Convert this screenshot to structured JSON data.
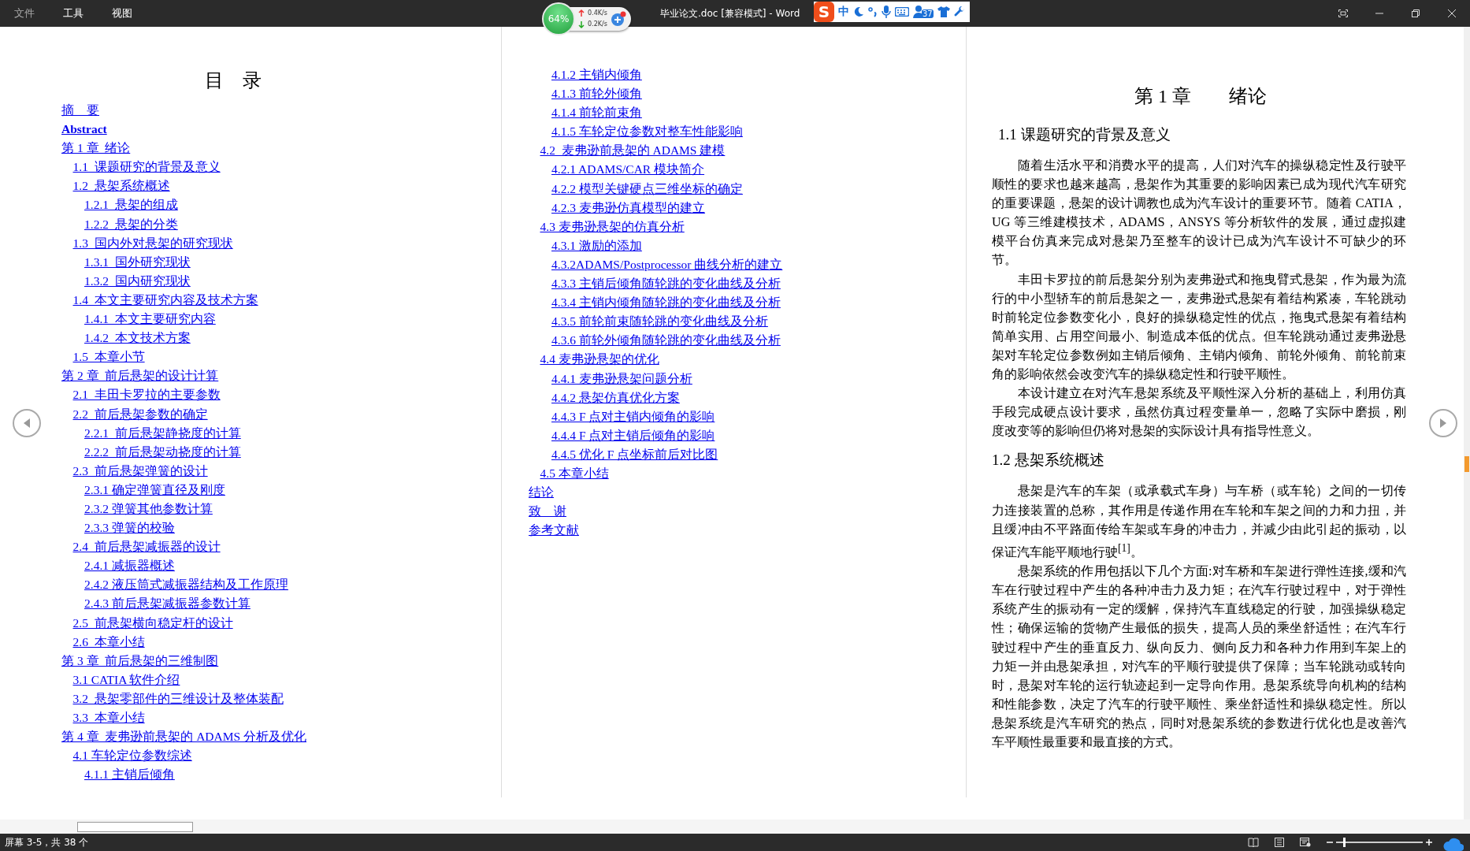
{
  "menu": [
    "文件",
    "工具",
    "视图"
  ],
  "monitor": {
    "percent": "64%",
    "upload": "0.4K/s",
    "download": "0.2K/s"
  },
  "window": {
    "title": "毕业论文.doc [兼容模式] - Word"
  },
  "ime_toolbar": {
    "logo": "S",
    "mode": "中",
    "badge": "37"
  },
  "toc": {
    "title": "目　录",
    "items": [
      {
        "label": "摘　要"
      },
      {
        "label": "Abstract",
        "bold": true
      },
      {
        "label": "第 1 章  绪论",
        "children": [
          {
            "label": "1.1  课题研究的背景及意义"
          },
          {
            "label": "1.2  悬架系统概述",
            "children": [
              {
                "label": "1.2.1  悬架的组成"
              },
              {
                "label": "1.2.2  悬架的分类"
              }
            ]
          },
          {
            "label": "1.3  国内外对悬架的研究现状",
            "children": [
              {
                "label": "1.3.1  国外研究现状"
              },
              {
                "label": "1.3.2  国内研究现状"
              }
            ]
          },
          {
            "label": "1.4  本文主要研究内容及技术方案",
            "children": [
              {
                "label": "1.4.1  本文主要研究内容"
              },
              {
                "label": "1.4.2  本文技术方案"
              }
            ]
          },
          {
            "label": "1.5  本章小节"
          }
        ]
      },
      {
        "label": "第 2 章  前后悬架的设计计算",
        "children": [
          {
            "label": "2.1  丰田卡罗拉的主要参数"
          },
          {
            "label": "2.2  前后悬架参数的确定",
            "children": [
              {
                "label": "2.2.1  前后悬架静挠度的计算"
              },
              {
                "label": "2.2.2  前后悬架动挠度的计算"
              }
            ]
          },
          {
            "label": "2.3  前后悬架弹簧的设计",
            "children": [
              {
                "label": "2.3.1 确定弹簧直径及刚度"
              },
              {
                "label": "2.3.2 弹簧其他参数计算"
              },
              {
                "label": "2.3.3 弹簧的校验"
              }
            ]
          },
          {
            "label": "2.4  前后悬架减振器的设计",
            "children": [
              {
                "label": "2.4.1 减振器概述"
              },
              {
                "label": "2.4.2 液压筒式减振器结构及工作原理"
              },
              {
                "label": "2.4.3 前后悬架减振器参数计算"
              }
            ]
          },
          {
            "label": "2.5  前悬架横向稳定杆的设计"
          },
          {
            "label": "2.6  本章小结"
          }
        ]
      },
      {
        "label": "第 3 章  前后悬架的三维制图",
        "children": [
          {
            "label": "3.1 CATIA 软件介绍"
          },
          {
            "label": "3.2  悬架零部件的三维设计及整体装配"
          },
          {
            "label": "3.3  本章小结"
          }
        ]
      },
      {
        "label": "第 4 章  麦弗逊前悬架的 ADAMS 分析及优化",
        "children": [
          {
            "label": "4.1 车轮定位参数综述",
            "children": [
              {
                "label": "4.1.1 主销后倾角"
              },
              {
                "label": "4.1.2 主销内倾角"
              },
              {
                "label": "4.1.3 前轮外倾角"
              },
              {
                "label": "4.1.4 前轮前束角"
              },
              {
                "label": "4.1.5 车轮定位参数对整车性能影响"
              }
            ]
          },
          {
            "label": "4.2  麦弗逊前悬架的 ADAMS 建模",
            "children": [
              {
                "label": "4.2.1 ADAMS/CAR 模块简介"
              },
              {
                "label": "4.2.2 模型关键硬点三维坐标的确定"
              },
              {
                "label": "4.2.3 麦弗逊仿真模型的建立"
              }
            ]
          },
          {
            "label": "4.3 麦弗逊悬架的仿真分析",
            "children": [
              {
                "label": "4.3.1 激励的添加"
              },
              {
                "label": "4.3.2ADAMS/Postprocessor 曲线分析的建立"
              },
              {
                "label": "4.3.3 主销后倾角随轮跳的变化曲线及分析"
              },
              {
                "label": "4.3.4 主销内倾角随轮跳的变化曲线及分析"
              },
              {
                "label": "4.3.5 前轮前束随轮跳的变化曲线及分析"
              },
              {
                "label": "4.3.6 前轮外倾角随轮跳的变化曲线及分析"
              }
            ]
          },
          {
            "label": "4.4 麦弗逊悬架的优化",
            "children": [
              {
                "label": "4.4.1 麦弗逊悬架问题分析"
              },
              {
                "label": "4.4.2 悬架仿真优化方案"
              },
              {
                "label": "4.4.3 F 点对主销内倾角的影响"
              },
              {
                "label": "4.4.4 F 点对主销后倾角的影响"
              },
              {
                "label": "4.4.5 优化 F 点坐标前后对比图"
              }
            ]
          },
          {
            "label": "4.5 本章小结"
          }
        ]
      },
      {
        "label": "结论"
      },
      {
        "label": "致　谢"
      },
      {
        "label": "参考文献"
      }
    ]
  },
  "chapter": {
    "title": "第 1 章　　绪论",
    "sections": [
      {
        "heading": "1.1 课题研究的背景及意义",
        "paragraphs": [
          "随着生活水平和消费水平的提高，人们对汽车的操纵稳定性及行驶平顺性的要求也越来越高，悬架作为其重要的影响因素已成为现代汽车研究的重要课题，悬架的设计调教也成为汽车设计的重要环节。随着 CATIA，UG 等三维建模技术，ADAMS，ANSYS 等分析软件的发展，通过虚拟建模平台仿真来完成对悬架乃至整车的设计已成为汽车设计不可缺少的环节。",
          "丰田卡罗拉的前后悬架分别为麦弗逊式和拖曳臂式悬架，作为最为流行的中小型轿车的前后悬架之一，麦弗逊式悬架有着结构紧凑，车轮跳动时前轮定位参数变化小，良好的操纵稳定性的优点，拖曳式悬架有着结构简单实用、占用空间最小、制造成本低的优点。但车轮跳动通过麦弗逊悬架对车轮定位参数例如主销后倾角、主销内倾角、前轮外倾角、前轮前束角的影响依然会改变汽车的操纵稳定性和行驶平顺性。",
          "本设计建立在对汽车悬架系统及平顺性深入分析的基础上，利用仿真手段完成硬点设计要求，虽然仿真过程变量单一，忽略了实际中磨损，刚度改变等的影响但仍将对悬架的实际设计具有指导性意义。"
        ]
      },
      {
        "heading": "1.2 悬架系统概述",
        "paragraphs": [
          "悬架是汽车的车架（或承载式车身）与车桥（或车轮）之间的一切传力连接装置的总称，其作用是传递作用在车轮和车架之间的力和力扭，并且缓冲由不平路面传给车架或车身的冲击力，并减少由此引起的振动，以保证汽车能平顺地行驶$^{[1]}$。",
          "悬架系统的作用包括以下几个方面:对车桥和车架进行弹性连接,缓和汽车在行驶过程中产生的各种冲击力及力矩；在汽车行驶过程中，对于弹性系统产生的振动有一定的缓解，保持汽车直线稳定的行驶，加强操纵稳定性；确保运输的货物产生最低的损失，提高人员的乘坐舒适性；在汽车行驶过程中产生的垂直反力、纵向反力、侧向反力和各种力作用到车架上的力矩一并由悬架承担，对汽车的平顺行驶提供了保障；当车轮跳动或转向时，悬架对车轮的运行轨迹起到一定导向作用。悬架系统导向机构的结构和性能参数，决定了汽车的行驶平顺性、乘坐舒适性和操纵稳定性。所以悬架系统是汽车研究的热点，同时对悬架系统的参数进行优化也是改善汽车平顺性最重要和最直接的方式。"
        ]
      }
    ]
  },
  "status_bar": {
    "page_info": "屏幕 3-5，共 38 个",
    "zoom": {
      "level": 0.08
    }
  }
}
